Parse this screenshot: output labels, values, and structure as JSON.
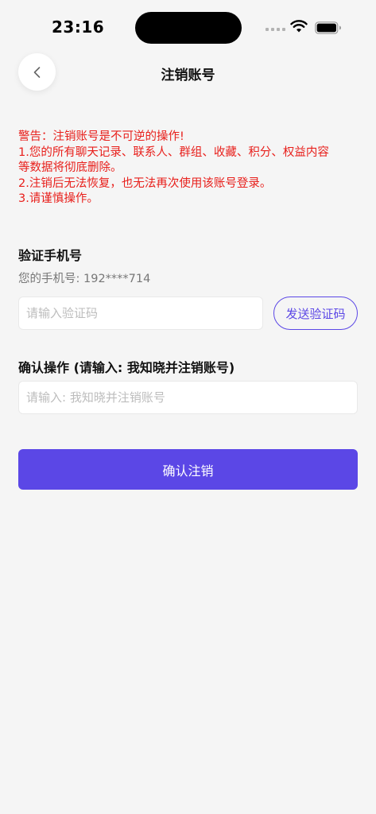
{
  "status_bar": {
    "time": "23:16"
  },
  "header": {
    "title": "注销账号",
    "back_icon": "chevron-left-icon"
  },
  "warning": {
    "lines": [
      "警告：注销账号是不可逆的操作!",
      "1.您的所有聊天记录、联系人、群组、收藏、积分、权益内容",
      "等数据将彻底删除。",
      "2.注销后无法恢复，也无法再次使用该账号登录。",
      "3.请谨慎操作。"
    ]
  },
  "verify": {
    "title": "验证手机号",
    "phone_label": "您的手机号: 192****714",
    "code_placeholder": "请输入验证码",
    "code_value": "",
    "send_code_label": "发送验证码"
  },
  "confirm": {
    "title": "确认操作 (请输入: 我知晓并注销账号)",
    "placeholder": "请输入: 我知晓并注销账号",
    "value": ""
  },
  "submit": {
    "label": "确认注销"
  },
  "colors": {
    "accent": "#5b47e6",
    "warning": "#e8201c",
    "background": "#f5f5f5"
  }
}
